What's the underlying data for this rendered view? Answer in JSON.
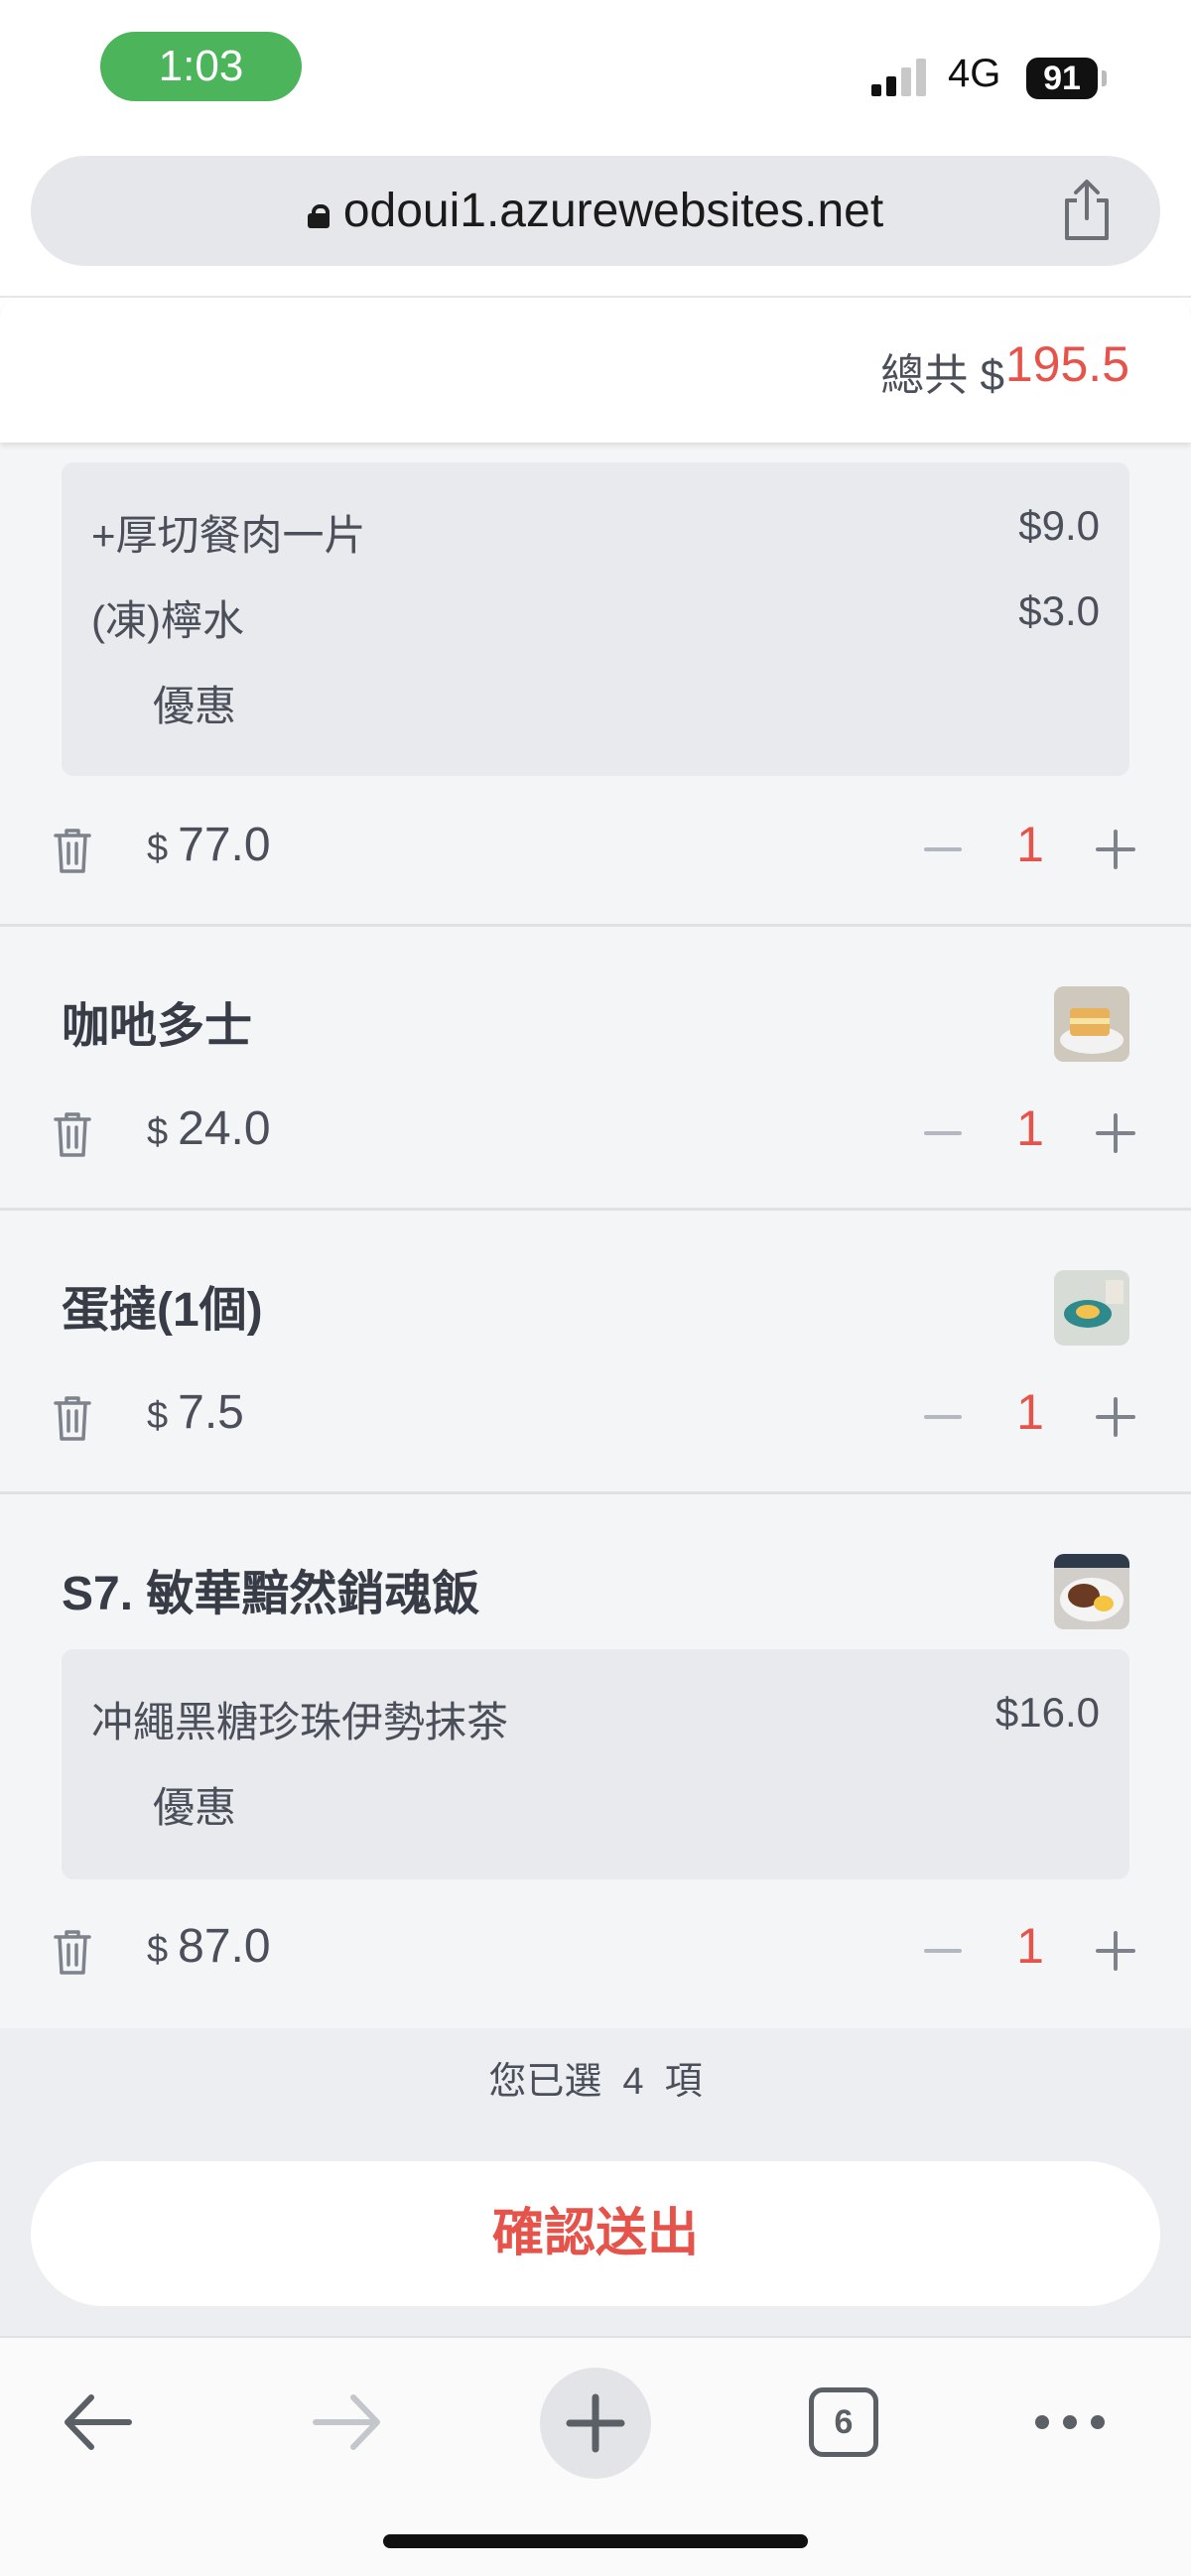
{
  "status_bar": {
    "time": "1:03",
    "network": "4G",
    "battery": "91"
  },
  "browser": {
    "url": "odoui1.azurewebsites.net",
    "tab_count": "6"
  },
  "summary": {
    "total_label": "總共 $",
    "total_value": "195.5"
  },
  "items": [
    {
      "addons": [
        {
          "name": "+厚切餐肉一片",
          "price": "$9.0"
        },
        {
          "name": "(凍)檸水",
          "price": "$3.0"
        }
      ],
      "discount": "優惠",
      "currency": "$",
      "price": "77.0",
      "quantity": "1"
    },
    {
      "name": "咖吔多士",
      "currency": "$",
      "price": "24.0",
      "quantity": "1"
    },
    {
      "name": "蛋撻(1個)",
      "currency": "$",
      "price": "7.5",
      "quantity": "1"
    },
    {
      "name": "S7. 敏華黯然銷魂飯",
      "addons": [
        {
          "name": "冲繩黑糖珍珠伊勢抹茶",
          "price": "$16.0"
        }
      ],
      "discount": "優惠",
      "currency": "$",
      "price": "87.0",
      "quantity": "1"
    }
  ],
  "selection": {
    "text": "您已選  4  項"
  },
  "actions": {
    "confirm_label": "確認送出"
  },
  "colors": {
    "accent": "#e5534b",
    "status_pill": "#4cb55b",
    "list_bg": "#f4f5f7"
  }
}
